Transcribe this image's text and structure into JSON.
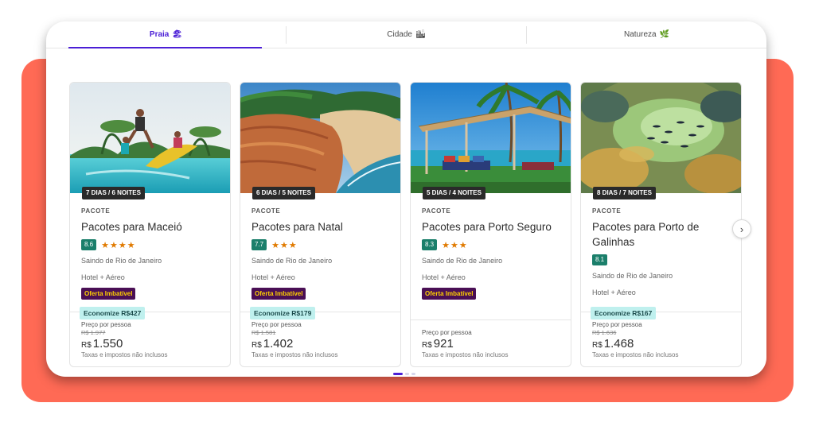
{
  "tabs": [
    {
      "label": "Praia",
      "icon": "🏖",
      "active": true
    },
    {
      "label": "Cidade",
      "icon": "🏙",
      "active": false
    },
    {
      "label": "Natureza",
      "icon": "🌿",
      "active": false
    }
  ],
  "cards": [
    {
      "duration": "7 DIAS / 6 NOITES",
      "kicker": "PACOTE",
      "title": "Pacotes para Maceió",
      "score": "8.6",
      "stars": "★★★★",
      "origin": "Saindo de Rio de Janeiro",
      "includes": "Hotel + Aéreo",
      "offer": "Oferta Imbatível",
      "savings_label": "Economize",
      "savings_value": "R$427",
      "per_person": "Preço por pessoa",
      "old_price": "R$ 1.977",
      "currency": "R$",
      "price": "1.550",
      "taxes": "Taxas e impostos não inclusos"
    },
    {
      "duration": "6 DIAS / 5 NOITES",
      "kicker": "PACOTE",
      "title": "Pacotes para Natal",
      "score": "7.7",
      "stars": "★★★",
      "origin": "Saindo de Rio de Janeiro",
      "includes": "Hotel + Aéreo",
      "offer": "Oferta Imbatível",
      "savings_label": "Economize",
      "savings_value": "R$179",
      "per_person": "Preço por pessoa",
      "old_price": "R$ 1.581",
      "currency": "R$",
      "price": "1.402",
      "taxes": "Taxas e impostos não inclusos"
    },
    {
      "duration": "5 DIAS / 4 NOITES",
      "kicker": "PACOTE",
      "title": "Pacotes para Porto Seguro",
      "score": "8.3",
      "stars": "★★★",
      "origin": "Saindo de Rio de Janeiro",
      "includes": "Hotel + Aéreo",
      "offer": "Oferta Imbatível",
      "per_person": "Preço por pessoa",
      "currency": "R$",
      "price": "921",
      "taxes": "Taxas e impostos não inclusos"
    },
    {
      "duration": "8 DIAS / 7 NOITES",
      "kicker": "PACOTE",
      "title": "Pacotes para Porto de Galinhas",
      "score": "8.1",
      "origin": "Saindo de Rio de Janeiro",
      "includes": "Hotel + Aéreo",
      "savings_label": "Economize",
      "savings_value": "R$167",
      "per_person": "Preço por pessoa",
      "old_price": "R$ 1.636",
      "currency": "R$",
      "price": "1.468",
      "taxes": "Taxas e impostos não inclusos"
    }
  ],
  "carousel": {
    "next_icon": "chevron-right-icon",
    "next_glyph": "›"
  },
  "colors": {
    "accent": "#4b1fd6",
    "score_bg": "#1b7f6b",
    "offer_bg": "#4a0f55",
    "offer_text": "#ffd000",
    "savings_bg": "#bff0ee",
    "backdrop": "#ff6a55"
  }
}
